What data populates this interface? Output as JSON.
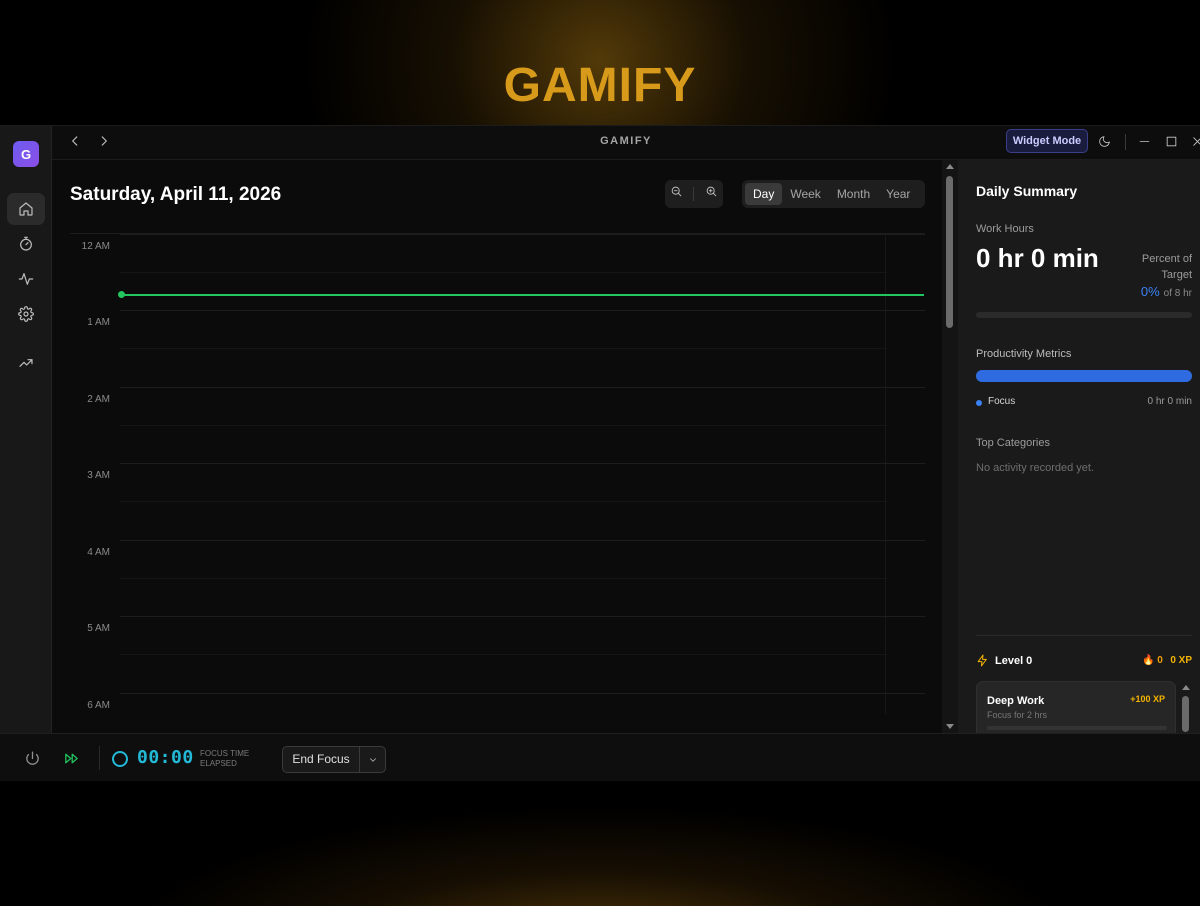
{
  "hero": {
    "title": "GAMIFY"
  },
  "titlebar": {
    "app_name": "GAMIFY",
    "widget_mode_label": "Widget Mode"
  },
  "sidebar": {
    "logo_letter": "G",
    "items": [
      {
        "name": "home",
        "icon": "home-icon",
        "active": true
      },
      {
        "name": "timer",
        "icon": "stopwatch-icon",
        "active": false
      },
      {
        "name": "activity",
        "icon": "activity-icon",
        "active": false
      },
      {
        "name": "settings",
        "icon": "gear-icon",
        "active": false
      },
      {
        "name": "trends",
        "icon": "trending-up-icon",
        "active": false
      }
    ]
  },
  "calendar": {
    "date_title": "Saturday, April 11, 2026",
    "views": [
      {
        "label": "Day",
        "active": true
      },
      {
        "label": "Week",
        "active": false
      },
      {
        "label": "Month",
        "active": false
      },
      {
        "label": "Year",
        "active": false
      }
    ],
    "hours": [
      "12 AM",
      "1 AM",
      "2 AM",
      "3 AM",
      "4 AM",
      "5 AM",
      "6 AM"
    ],
    "current_time_color": "#22c55e"
  },
  "summary": {
    "title": "Daily Summary",
    "work_hours_label": "Work Hours",
    "work_hours_value": "0 hr 0 min",
    "percent_label": "Percent of Target",
    "percent_value": "0%",
    "percent_target": "of 8 hr",
    "productivity_label": "Productivity Metrics",
    "legend": {
      "name": "Focus",
      "value": "0 hr 0 min",
      "color": "#3b82f6"
    },
    "top_categories_label": "Top Categories",
    "top_categories_empty": "No activity recorded yet."
  },
  "level": {
    "label": "Level 0",
    "streak": "0",
    "xp_total": "0 XP",
    "quest": {
      "title": "Deep Work",
      "xp": "+100 XP",
      "subtitle": "Focus for 2 hrs"
    }
  },
  "bottombar": {
    "timer_value": "00:00",
    "timer_label": "FOCUS TIME ELAPSED",
    "end_focus_label": "End Focus"
  }
}
